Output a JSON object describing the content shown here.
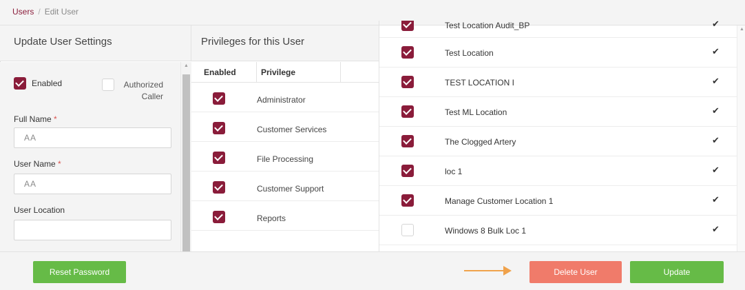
{
  "breadcrumb": {
    "root": "Users",
    "separator": "/",
    "current": "Edit User"
  },
  "settings": {
    "title": "Update User Settings",
    "enabled_label": "Enabled",
    "enabled_checked": true,
    "authorized_label_line1": "Authorized",
    "authorized_label_line2": "Caller",
    "authorized_checked": false,
    "full_name_label": "Full Name",
    "full_name_value": "AA",
    "user_name_label": "User Name",
    "user_name_value": "AA",
    "user_location_label": "User Location",
    "user_location_value": "",
    "required_mark": "*"
  },
  "privileges": {
    "title": "Privileges for this User",
    "col_enabled": "Enabled",
    "col_privilege": "Privilege",
    "rows": [
      {
        "label": "Administrator",
        "checked": true
      },
      {
        "label": "Customer Services",
        "checked": true
      },
      {
        "label": "File Processing",
        "checked": true
      },
      {
        "label": "Customer Support",
        "checked": true
      },
      {
        "label": "Reports",
        "checked": true
      }
    ]
  },
  "locations": {
    "rows": [
      {
        "label": "Test Location Audit_BP",
        "checked": true,
        "mark": "✔"
      },
      {
        "label": "Test Location",
        "checked": true,
        "mark": "✔"
      },
      {
        "label": "TEST LOCATION I",
        "checked": true,
        "mark": "✔"
      },
      {
        "label": "Test ML Location",
        "checked": true,
        "mark": "✔"
      },
      {
        "label": "The Clogged Artery",
        "checked": true,
        "mark": "✔"
      },
      {
        "label": "loc 1",
        "checked": true,
        "mark": "✔"
      },
      {
        "label": "Manage Customer Location 1",
        "checked": true,
        "mark": "✔"
      },
      {
        "label": "Windows 8 Bulk Loc 1",
        "checked": false,
        "mark": "✔"
      }
    ]
  },
  "footer": {
    "reset_password": "Reset Password",
    "delete_user": "Delete User",
    "update": "Update"
  },
  "colors": {
    "accent": "#8a1c3a",
    "green": "#66bb47",
    "red": "#f07b6a",
    "arrow": "#f0a24b"
  }
}
